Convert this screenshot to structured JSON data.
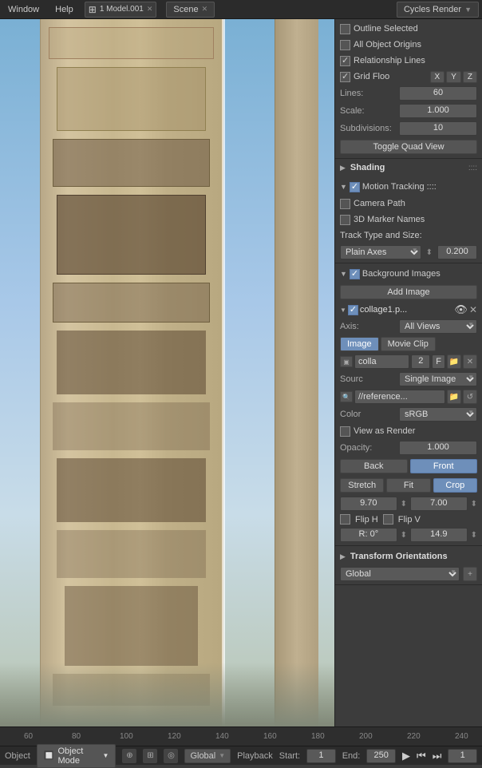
{
  "topbar": {
    "window_label": "1 Model.001",
    "scene_label": "Scene",
    "render_label": "Cycles Render",
    "menu_items": [
      "Window",
      "Help"
    ]
  },
  "overlays": {
    "outline_selected_label": "Outline Selected",
    "all_object_origins_label": "All Object Origins",
    "relationship_lines_label": "Relationship Lines",
    "grid_floo_label": "Grid Floo",
    "grid_x": "X",
    "grid_y": "Y",
    "grid_z": "Z",
    "lines_label": "Lines:",
    "lines_value": "60",
    "scale_label": "Scale:",
    "scale_value": "1.000",
    "subdivisions_label": "Subdivisions:",
    "subdivisions_value": "10"
  },
  "buttons": {
    "toggle_quad_view": "Toggle Quad View",
    "add_image": "Add Image",
    "back": "Back",
    "front": "Front",
    "stretch": "Stretch",
    "fit": "Fit",
    "crop": "Crop"
  },
  "shading": {
    "label": "Shading",
    "dots": "::::"
  },
  "motion_tracking": {
    "label": "Motion Tracking",
    "dots": "::::",
    "camera_path_label": "Camera Path",
    "marker_names_label": "3D Marker Names",
    "track_type_label": "Track Type and Size:",
    "track_value": "Plain Axes",
    "track_number": "0.200"
  },
  "background_images": {
    "label": "Background Images",
    "collage_name": "collage1.p...",
    "axis_label": "Axis:",
    "axis_value": "All Views",
    "image_tab": "Image",
    "movie_clip_tab": "Movie Clip",
    "colla_label": "colla",
    "frame_num": "2",
    "f_label": "F",
    "source_label": "Sourc",
    "source_value": "Single Image",
    "file_label": "//reference...",
    "color_label": "Color",
    "color_value": "sRGB",
    "view_as_render": "View as Render",
    "opacity_label": "Opacity:",
    "opacity_value": "1.000",
    "x_val": "9.70",
    "y_val": "7.00",
    "flip_h": "Flip H",
    "flip_v": "Flip V",
    "r_label": "R: 0°",
    "r_value": "14.9"
  },
  "transform_orientations": {
    "label": "Transform Orientations",
    "value": "Global"
  },
  "bottom_status": {
    "object_label": "Object",
    "mode_label": "Object Mode",
    "global_label": "Global",
    "start_label": "Start:",
    "start_value": "1",
    "end_label": "End:",
    "end_value": "250",
    "playback_label": "Playback",
    "frame_value": "1"
  },
  "timeline_numbers": [
    "60",
    "80",
    "100",
    "120",
    "140",
    "160",
    "180",
    "200",
    "220",
    "240"
  ]
}
